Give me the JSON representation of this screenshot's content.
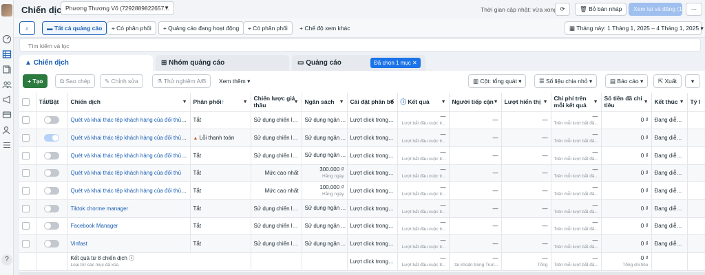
{
  "header": {
    "title": "Chiến dịch",
    "account": "Phương Thương Võ (7292889822657...",
    "updated": "Thời gian cập nhật: vừa xong",
    "discard": "Bỏ bản nháp",
    "review": "Xem lại và đăng (1)",
    "more": "···"
  },
  "filters": {
    "items": [
      "Tất cả quảng cáo",
      "Có phân phối",
      "Quảng cáo đang hoạt động",
      "Có phân phối"
    ],
    "more_views": "Chế độ xem khác",
    "date": "Tháng này: 1 Tháng 1, 2025 – 4 Tháng 1, 2025"
  },
  "search": {
    "placeholder": "Tìm kiếm và lọc"
  },
  "tabs": [
    "Chiến dịch",
    "Nhóm quảng cáo",
    "Quảng cáo"
  ],
  "selected_badge": "Đã chọn 1 mục",
  "toolbar": {
    "create": "Tạo",
    "copy": "Sao chép",
    "edit": "Chỉnh sửa",
    "abtest": "Thử nghiệm A/B",
    "more": "Xem thêm",
    "columns": "Cột: tổng quát",
    "breakdown": "Số liệu chia nhỏ",
    "report": "Báo cáo",
    "export": "Xuất"
  },
  "columns": [
    "Tắt/Bật",
    "Chiến dịch",
    "Phân phối",
    "Chiến lược giá thầu",
    "Ngân sách",
    "Cài đặt phân bổ",
    "Kết quả",
    "Người tiếp cận",
    "Lượt hiển thị",
    "Chi phí trên mỗi kết quả",
    "Số tiền đã chi tiêu",
    "Kết thúc",
    "Tỷ l"
  ],
  "rows": [
    {
      "name": "Quét và khai thác tệp khách hàng của đối thủ -...",
      "status": "Tắt",
      "bid": "Sử dụng chiến lư...",
      "budget": "Sử dụng ngân ...",
      "budget_sub": "",
      "attr": "Lượt click trong ...",
      "result": "—",
      "result_sub": "Lượt bắt đầu cuộc tr...",
      "reach": "—",
      "impr": "—",
      "cpr": "—",
      "cpr_sub": "Trên mỗi lượt bắt đầ...",
      "spent": "0 ₫",
      "end": "Đang diễn ra",
      "on": false
    },
    {
      "name": "Quét và khai thác tệp khách hàng của đối thủ -...",
      "status": "Lỗi thanh toán",
      "bid": "Sử dụng chiến lư...",
      "budget": "Sử dụng ngân ...",
      "budget_sub": "",
      "attr": "Lượt click trong ...",
      "result": "—",
      "result_sub": "Lượt bắt đầu cuộc tr...",
      "reach": "—",
      "impr": "—",
      "cpr": "—",
      "cpr_sub": "Trên mỗi lượt bắt đầ...",
      "spent": "0 ₫",
      "end": "Đang diễn ra",
      "on": true
    },
    {
      "name": "Quét và khai thác tệp khách hàng của đối thủ -...",
      "status": "Tắt",
      "bid": "Sử dụng chiến lư...",
      "budget": "Sử dụng ngân ...",
      "budget_sub": "",
      "attr": "Lượt click trong ...",
      "result": "—",
      "result_sub": "Lượt bắt đầu cuộc tr...",
      "reach": "—",
      "impr": "—",
      "cpr": "—",
      "cpr_sub": "Trên mỗi lượt bắt đầ...",
      "spent": "0 ₫",
      "end": "Đang diễn ra",
      "on": false
    },
    {
      "name": "Quét và khai thác tệp khách hàng của đối thủ",
      "status": "Tắt",
      "bid": "Mức cao nhất",
      "budget": "300.000 ₫",
      "budget_sub": "Hằng ngày",
      "attr": "Lượt click trong ...",
      "result": "—",
      "result_sub": "Lượt bắt đầu cuộc tr...",
      "reach": "—",
      "impr": "—",
      "cpr": "—",
      "cpr_sub": "Trên mỗi lượt bắt đầ...",
      "spent": "0 ₫",
      "end": "Đang diễn ra",
      "on": false
    },
    {
      "name": "Quét và khai thác tệp khách hàng của đối thủ -...",
      "status": "Tắt",
      "bid": "Mức cao nhất",
      "budget": "100.000 ₫",
      "budget_sub": "Hằng ngày",
      "attr": "Lượt click trong ...",
      "result": "—",
      "result_sub": "Lượt bắt đầu cuộc tr...",
      "reach": "—",
      "impr": "—",
      "cpr": "—",
      "cpr_sub": "Trên mỗi lượt bắt đầ...",
      "spent": "0 ₫",
      "end": "Đang diễn ra",
      "on": false
    },
    {
      "name": "Tiktok chorme manager",
      "status": "Tắt",
      "bid": "Sử dụng chiến lư...",
      "budget": "Sử dụng ngân ...",
      "budget_sub": "",
      "attr": "Lượt click trong ...",
      "result": "—",
      "result_sub": "Lượt bắt đầu cuộc tr...",
      "reach": "—",
      "impr": "—",
      "cpr": "—",
      "cpr_sub": "Trên mỗi lượt bắt đầ...",
      "spent": "0 ₫",
      "end": "Đang diễn ra",
      "on": false
    },
    {
      "name": "Facebook Manager",
      "status": "Tắt",
      "bid": "Sử dụng chiến lư...",
      "budget": "Sử dụng ngân ...",
      "budget_sub": "",
      "attr": "Lượt click trong ...",
      "result": "—",
      "result_sub": "Lượt bắt đầu cuộc tr...",
      "reach": "—",
      "impr": "—",
      "cpr": "—",
      "cpr_sub": "Trên mỗi lượt bắt đầ...",
      "spent": "0 ₫",
      "end": "Đang diễn ra",
      "on": false
    },
    {
      "name": "Vinfast",
      "status": "Tắt",
      "bid": "Sử dụng chiến lư...",
      "budget": "Sử dụng ngân ...",
      "budget_sub": "",
      "attr": "Lượt click trong ...",
      "result": "—",
      "result_sub": "Lượt bắt đầu cuộc tr...",
      "reach": "—",
      "impr": "—",
      "cpr": "—",
      "cpr_sub": "Trên mỗi lượt bắt đầ...",
      "spent": "0 ₫",
      "end": "Đang diễn ra",
      "on": false
    }
  ],
  "summary": {
    "label": "Kết quả từ 8 chiến dịch",
    "sub": "Loại trừ các mục đã xóa",
    "attr": "Lượt click trong ...",
    "result": "—",
    "result_sub": "Lượt bắt đầu cuộc tr...",
    "reach": "—",
    "reach_sub": "tài khoản trong Trun...",
    "impr": "—",
    "impr_sub": "Tổng",
    "cpr": "—",
    "cpr_sub": "Trên mỗi lượt bắt đầ...",
    "spent": "0 ₫",
    "spent_sub": "Tổng chi tiêu"
  },
  "colors": {
    "accent": "#1a5fb4",
    "create": "#2b7a3e",
    "badge": "#1a73e8"
  }
}
